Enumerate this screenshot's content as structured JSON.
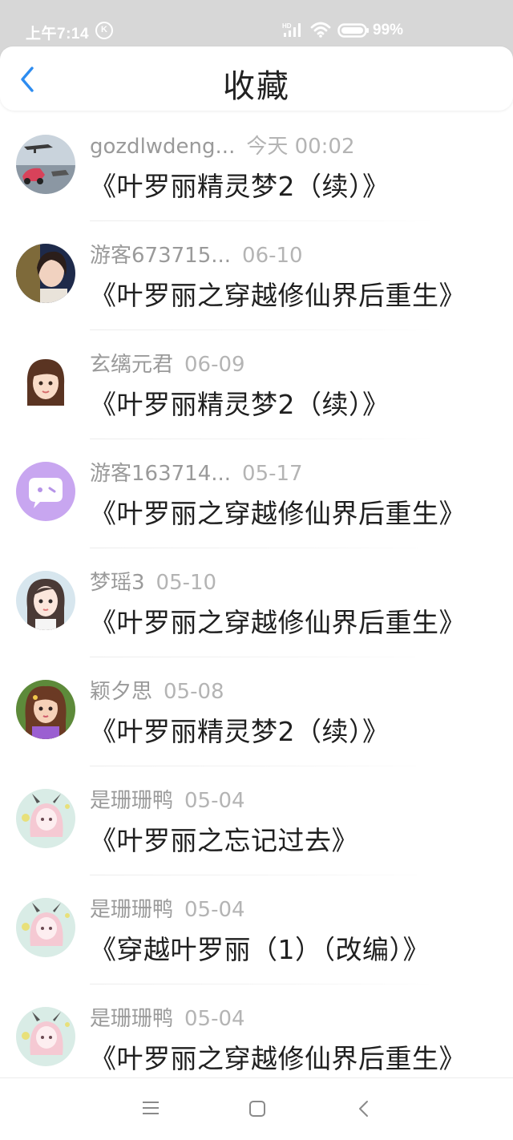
{
  "status_bar": {
    "time": "上午7:14",
    "k_badge": "K",
    "battery": "99%",
    "signal_label": "HD"
  },
  "header": {
    "title": "收藏",
    "back_icon": "chevron-left-icon"
  },
  "colors": {
    "accent": "#2d8cf0",
    "status_bar_bg": "#d7d7d7",
    "meta_text": "#9a9a9a",
    "title_text": "#1f1f1f"
  },
  "favorites": [
    {
      "user": "gozdlwdeng...",
      "time": "今天 00:02",
      "title": "《叶罗丽精灵梦2（续）》",
      "avatar": "race-car-avatar"
    },
    {
      "user": "游客673715...",
      "time": "06-10",
      "title": "《叶罗丽之穿越修仙界后重生》",
      "avatar": "girl-photo-avatar"
    },
    {
      "user": "玄缡元君",
      "time": "06-09",
      "title": "《叶罗丽精灵梦2（续）》",
      "avatar": "cartoon-girl-avatar"
    },
    {
      "user": "游客163714...",
      "time": "05-17",
      "title": "《叶罗丽之穿越修仙界后重生》",
      "avatar": "purple-chat-avatar"
    },
    {
      "user": "梦瑶3",
      "time": "05-10",
      "title": "《叶罗丽之穿越修仙界后重生》",
      "avatar": "doll-girl-avatar"
    },
    {
      "user": "颖夕思",
      "time": "05-08",
      "title": "《叶罗丽精灵梦2（续）》",
      "avatar": "doll-brown-hair-avatar"
    },
    {
      "user": "是珊珊鸭",
      "time": "05-04",
      "title": "《叶罗丽之忘记过去》",
      "avatar": "anime-pink-hair-avatar"
    },
    {
      "user": "是珊珊鸭",
      "time": "05-04",
      "title": "《穿越叶罗丽（1）（改编）》",
      "avatar": "anime-pink-hair-avatar"
    },
    {
      "user": "是珊珊鸭",
      "time": "05-04",
      "title": "《叶罗丽之穿越修仙界后重生》",
      "avatar": "anime-pink-hair-avatar"
    }
  ],
  "nav_bar": {
    "menu_icon": "menu-icon",
    "home_icon": "home-square-icon",
    "back_icon": "back-triangle-icon"
  }
}
